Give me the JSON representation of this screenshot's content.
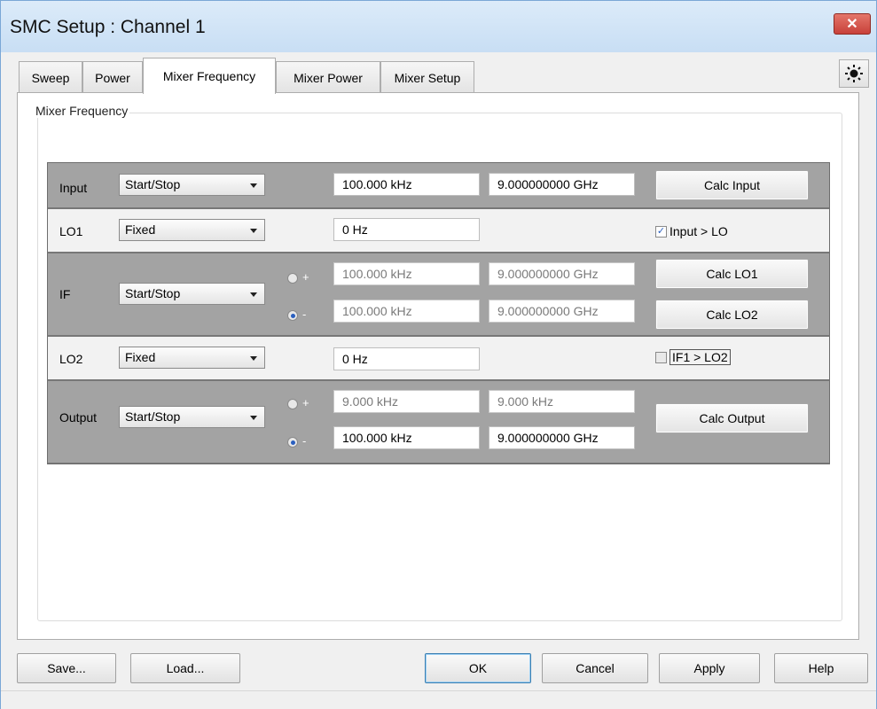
{
  "window": {
    "title": "SMC Setup : Channel 1",
    "close_icon": "close-icon"
  },
  "tabs": [
    {
      "label": "Sweep",
      "active": false
    },
    {
      "label": "Power",
      "active": false
    },
    {
      "label": "Mixer Frequency",
      "active": true
    },
    {
      "label": "Mixer Power",
      "active": false
    },
    {
      "label": "Mixer Setup",
      "active": false
    }
  ],
  "tab_corner_icon": "brightness-sun-icon",
  "group": {
    "label": "Mixer Frequency"
  },
  "rows": {
    "input": {
      "label": "Input",
      "mode": "Start/Stop",
      "start": "100.000 kHz",
      "stop": "9.000000000 GHz",
      "button": "Calc Input"
    },
    "lo1": {
      "label": "LO1",
      "mode": "Fixed",
      "value": "0 Hz",
      "check_label": "Input > LO",
      "checked": true
    },
    "if": {
      "label": "IF",
      "mode": "Start/Stop",
      "plus_sign": "+",
      "minus_sign": "-",
      "plus_selected": false,
      "minus_selected": true,
      "plus_start": "100.000 kHz",
      "plus_stop": "9.000000000 GHz",
      "minus_start": "100.000 kHz",
      "minus_stop": "9.000000000 GHz",
      "button1": "Calc LO1",
      "button2": "Calc LO2"
    },
    "lo2": {
      "label": "LO2",
      "mode": "Fixed",
      "value": "0 Hz",
      "check_label": "IF1 > LO2",
      "checked": false
    },
    "output": {
      "label": "Output",
      "mode": "Start/Stop",
      "plus_sign": "+",
      "minus_sign": "-",
      "plus_selected": false,
      "minus_selected": true,
      "plus_start": "9.000 kHz",
      "plus_stop": "9.000 kHz",
      "minus_start": "100.000 kHz",
      "minus_stop": "9.000000000 GHz",
      "button": "Calc Output"
    }
  },
  "footer": {
    "save": "Save...",
    "load": "Load...",
    "ok": "OK",
    "cancel": "Cancel",
    "apply": "Apply",
    "help": "Help"
  }
}
